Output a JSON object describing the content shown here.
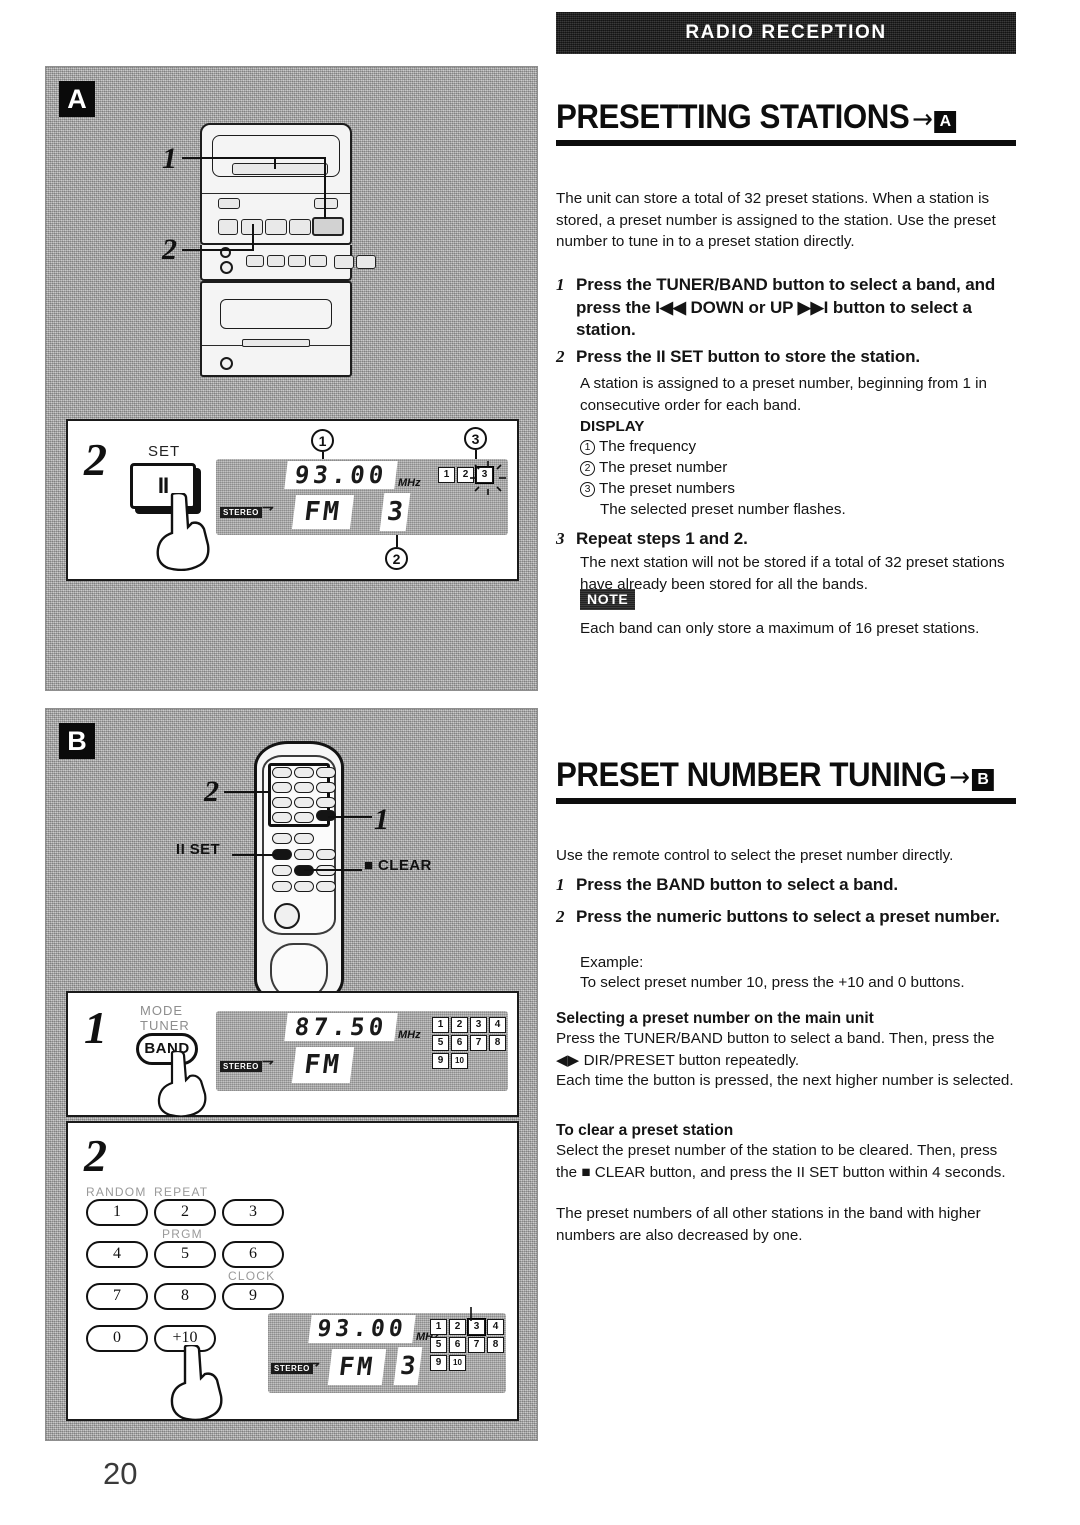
{
  "page": {
    "number": "20"
  },
  "chapter": {
    "title": "RADIO RECEPTION"
  },
  "sections": [
    {
      "heading": "PRESETTING STATIONS",
      "arrow": "→",
      "badge": "A",
      "intro": "The unit can store a total of 32 preset stations.  When a station is stored, a preset number is assigned to the station.  Use the preset number to tune in to a preset station directly.",
      "steps": [
        {
          "index": "1",
          "text": "Press the TUNER/BAND button to select a band, and press the I◀◀ DOWN or UP ▶▶I button to select a station."
        },
        {
          "index": "2",
          "text": "Press the II SET button to store the station."
        },
        {
          "index": "3",
          "text": "Repeat steps 1 and 2."
        }
      ],
      "step2_sub": "A station is assigned to a preset number, beginning from 1 in consecutive order for each band.",
      "display_heading": "DISPLAY",
      "display_items": [
        {
          "num": "1",
          "text": "The frequency"
        },
        {
          "num": "2",
          "text": "The preset number"
        },
        {
          "num": "3",
          "text": "The preset numbers"
        }
      ],
      "display_note": "The selected preset number flashes.",
      "step3_sub": "The next station will not be stored if a total of 32 preset stations have already been stored for all the bands.",
      "note_badge": "NOTE",
      "note_text": "Each band can only store a maximum of 16 preset stations."
    },
    {
      "heading": "PRESET NUMBER TUNING",
      "arrow": "→",
      "badge": "B",
      "intro": "Use the remote control to select the preset number directly.",
      "steps": [
        {
          "index": "1",
          "text": "Press the BAND button to select a band."
        },
        {
          "index": "2",
          "text": "Press the numeric buttons to select a preset number."
        }
      ],
      "example_label": "Example:",
      "example_text": "To select preset number 10, press the +10 and 0 buttons.",
      "subsections": [
        {
          "title": "Selecting a preset number on the main unit",
          "lines": [
            "Press the TUNER/BAND button to select a band.  Then, press the ◀▶ DIR/PRESET button repeatedly.",
            "Each time the button is pressed, the next higher number is selected."
          ]
        },
        {
          "title": "To clear a preset station",
          "lines": [
            "Select the preset number of the station to be cleared.  Then, press the ■ CLEAR button, and press the II SET button within 4 seconds.",
            "The preset numbers of all other stations in the band with higher numbers are also decreased by one."
          ]
        }
      ]
    }
  ],
  "figures": {
    "panel_a": {
      "badge": "A",
      "callouts": [
        {
          "label": "1"
        },
        {
          "label": "2"
        }
      ],
      "detail": {
        "step": "2",
        "key_caption": "SET",
        "key_glyph": "II",
        "refs": [
          "1",
          "2",
          "3"
        ],
        "lcd": {
          "frequency": "93.00",
          "unit": "MHz",
          "band": "FM",
          "preset": "3",
          "stereo": "STEREO",
          "preset_cells": [
            "1",
            "2",
            "3"
          ],
          "flashing_cell": "3"
        }
      }
    },
    "panel_b": {
      "badge": "B",
      "callouts": [
        {
          "label": "2"
        },
        {
          "label": "1"
        },
        {
          "label": "II SET"
        },
        {
          "label": "■ CLEAR"
        }
      ],
      "detail1": {
        "step": "1",
        "key_caption_1": "MODE",
        "key_caption_2": "TUNER",
        "key_label": "BAND",
        "lcd": {
          "frequency": "87.50",
          "unit": "MHz",
          "band": "FM",
          "preset": "",
          "stereo": "STEREO",
          "preset_cells": [
            "1",
            "2",
            "3",
            "4",
            "5",
            "6",
            "7",
            "8",
            "9",
            "10"
          ],
          "flashing_cell": ""
        }
      },
      "detail2": {
        "step": "2",
        "keypad": [
          {
            "key": "1",
            "caption": "RANDOM"
          },
          {
            "key": "2",
            "caption": "REPEAT"
          },
          {
            "key": "3",
            "caption": ""
          },
          {
            "key": "4",
            "caption": ""
          },
          {
            "key": "5",
            "caption": "PRGM"
          },
          {
            "key": "6",
            "caption": ""
          },
          {
            "key": "7",
            "caption": ""
          },
          {
            "key": "8",
            "caption": ""
          },
          {
            "key": "9",
            "caption": "CLOCK"
          },
          {
            "key": "0",
            "caption": ""
          },
          {
            "key": "+10",
            "caption": ""
          }
        ],
        "lcd": {
          "frequency": "93.00",
          "unit": "MHz",
          "band": "FM",
          "preset": "3",
          "stereo": "STEREO",
          "preset_cells": [
            "1",
            "2",
            "3",
            "4",
            "5",
            "6",
            "7",
            "8",
            "9",
            "10"
          ],
          "flashing_cell": "3"
        }
      }
    }
  }
}
